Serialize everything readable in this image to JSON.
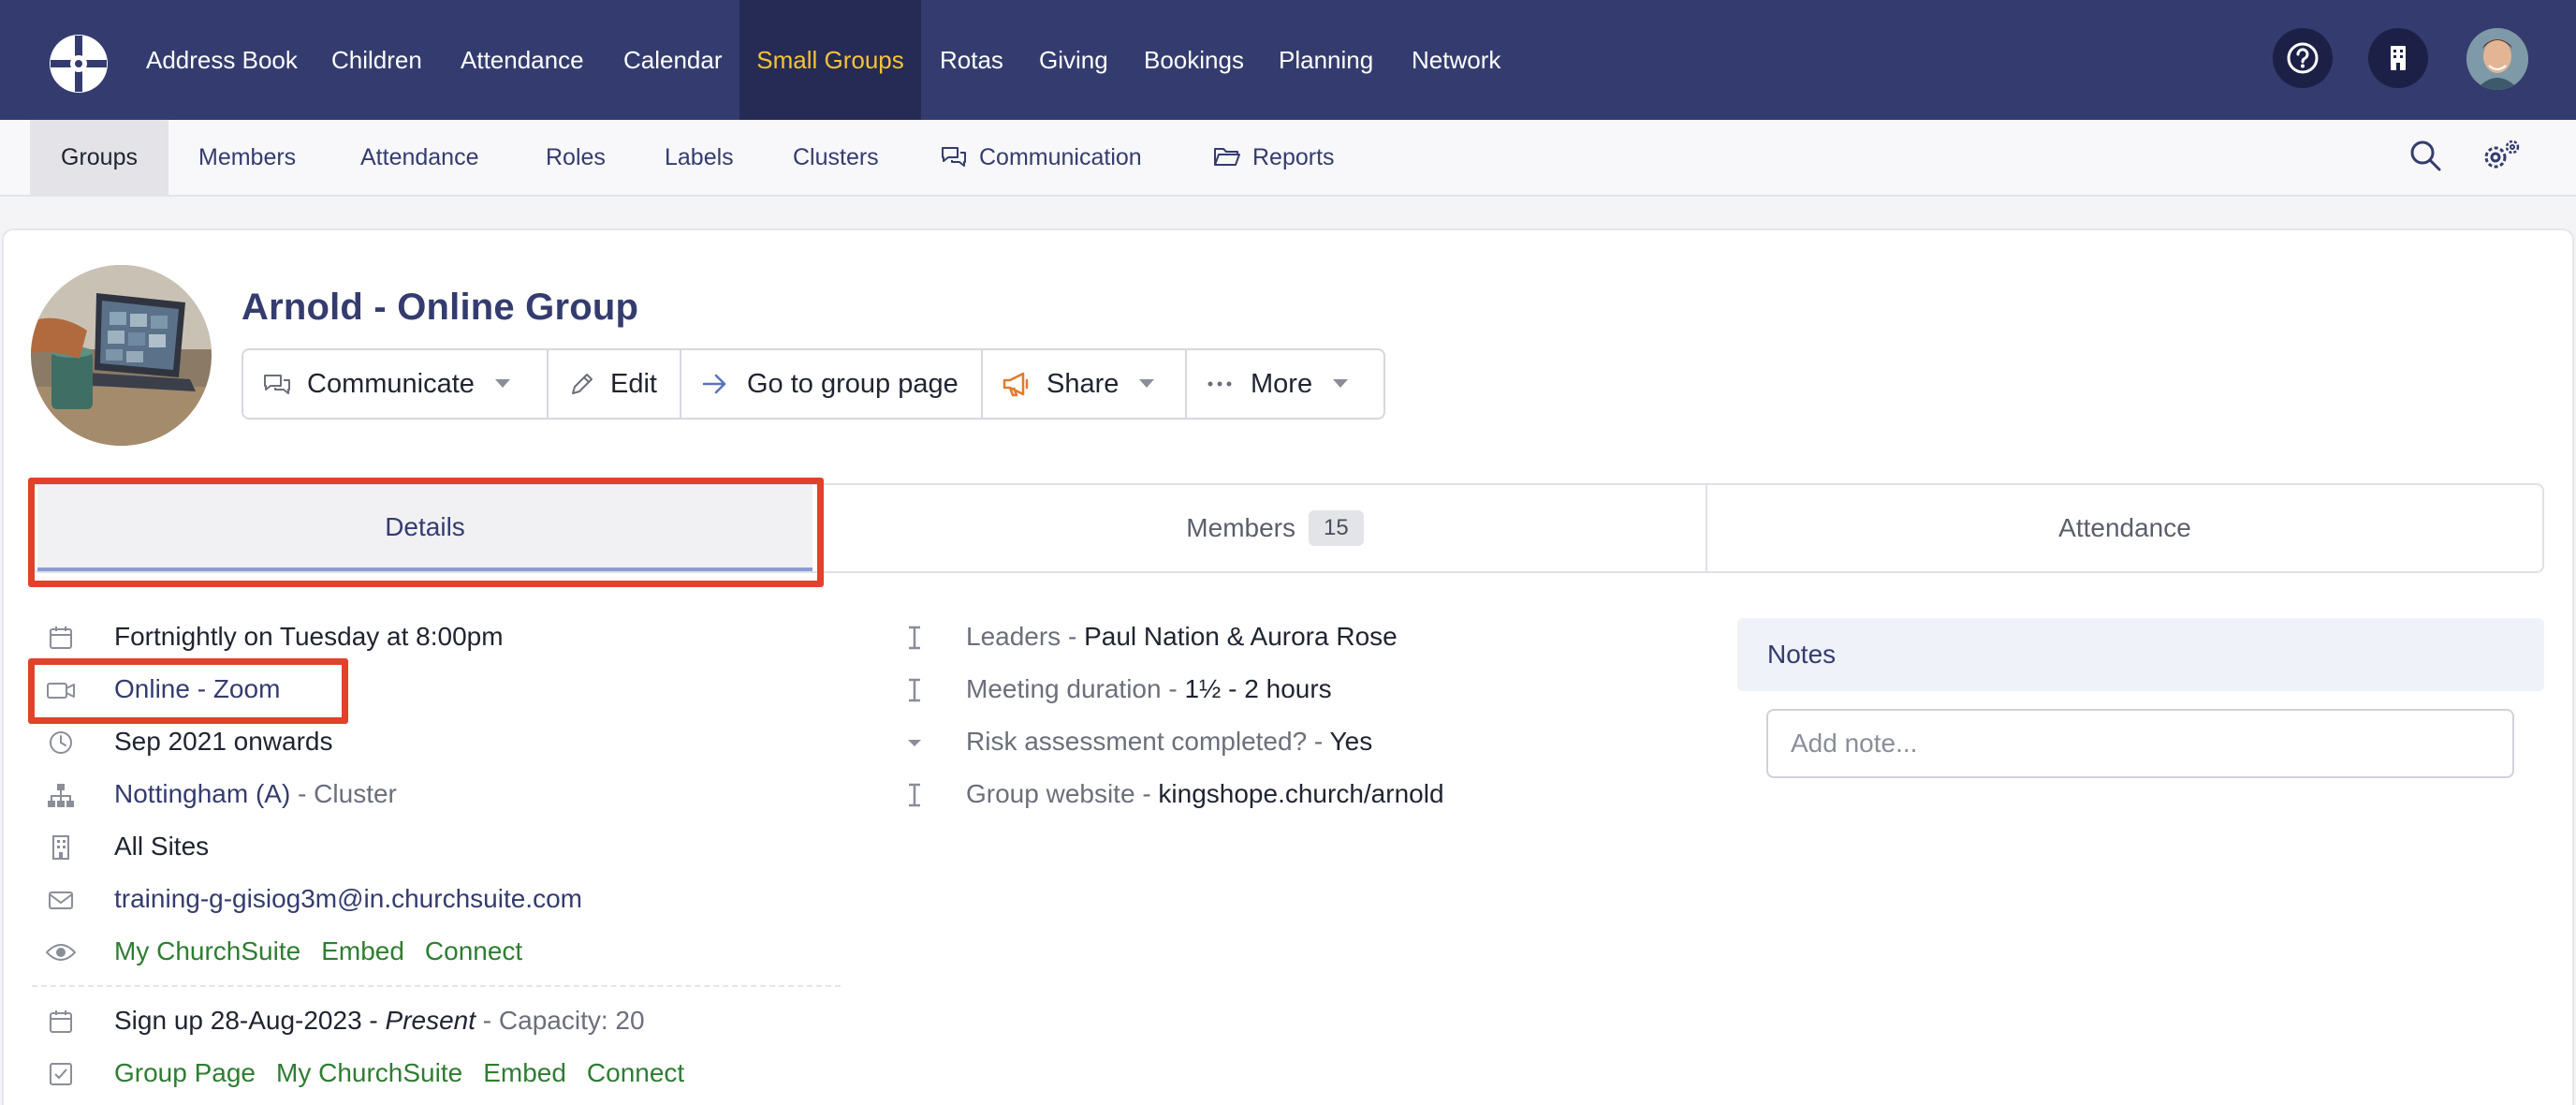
{
  "topnav": {
    "items": [
      {
        "label": "Address Book"
      },
      {
        "label": "Children"
      },
      {
        "label": "Attendance"
      },
      {
        "label": "Calendar"
      },
      {
        "label": "Small Groups",
        "active": true
      },
      {
        "label": "Rotas"
      },
      {
        "label": "Giving"
      },
      {
        "label": "Bookings"
      },
      {
        "label": "Planning"
      },
      {
        "label": "Network"
      }
    ],
    "icons": [
      "help-icon",
      "building-icon"
    ],
    "accent_color": "#f5c23a",
    "background_color": "#343c6f"
  },
  "subnav": {
    "items": [
      {
        "label": "Groups",
        "active": true
      },
      {
        "label": "Members"
      },
      {
        "label": "Attendance"
      },
      {
        "label": "Roles"
      },
      {
        "label": "Labels"
      },
      {
        "label": "Clusters"
      },
      {
        "label": "Communication",
        "icon": "chat-icon"
      },
      {
        "label": "Reports",
        "icon": "folder-icon"
      }
    ],
    "right_icons": [
      "search-icon",
      "gear-icon"
    ]
  },
  "group": {
    "title": "Arnold - Online Group",
    "actions": {
      "communicate": "Communicate",
      "edit": "Edit",
      "go_to_group_page": "Go to group page",
      "share": "Share",
      "more": "More"
    }
  },
  "tabs": {
    "details": "Details",
    "members": "Members",
    "members_count": "15",
    "attendance": "Attendance"
  },
  "details": {
    "schedule": "Fortnightly on Tuesday at 8:00pm",
    "location": "Online - Zoom",
    "start": "Sep 2021 onwards",
    "cluster_name": "Nottingham (A)",
    "cluster_suffix": " - Cluster",
    "sites": "All Sites",
    "email": "training-g-gisiog3m@in.churchsuite.com",
    "visibility": [
      "My ChurchSuite",
      "Embed",
      "Connect"
    ],
    "signup_prefix": "Sign up 28-Aug-2023 - ",
    "signup_present": "Present",
    "signup_capacity": " - Capacity: 20",
    "signup_links": [
      "Group Page",
      "My ChurchSuite",
      "Embed",
      "Connect"
    ]
  },
  "meta": [
    {
      "label": "Leaders - ",
      "value": "Paul Nation & Aurora Rose"
    },
    {
      "label": "Meeting duration - ",
      "value": "1½ - 2 hours"
    },
    {
      "label": "Risk assessment completed? - ",
      "value": "Yes"
    },
    {
      "label": "Group website - ",
      "value": "kingshope.church/arnold"
    }
  ],
  "notes": {
    "title": "Notes",
    "placeholder": "Add note..."
  },
  "highlight_color": "#e2412b"
}
